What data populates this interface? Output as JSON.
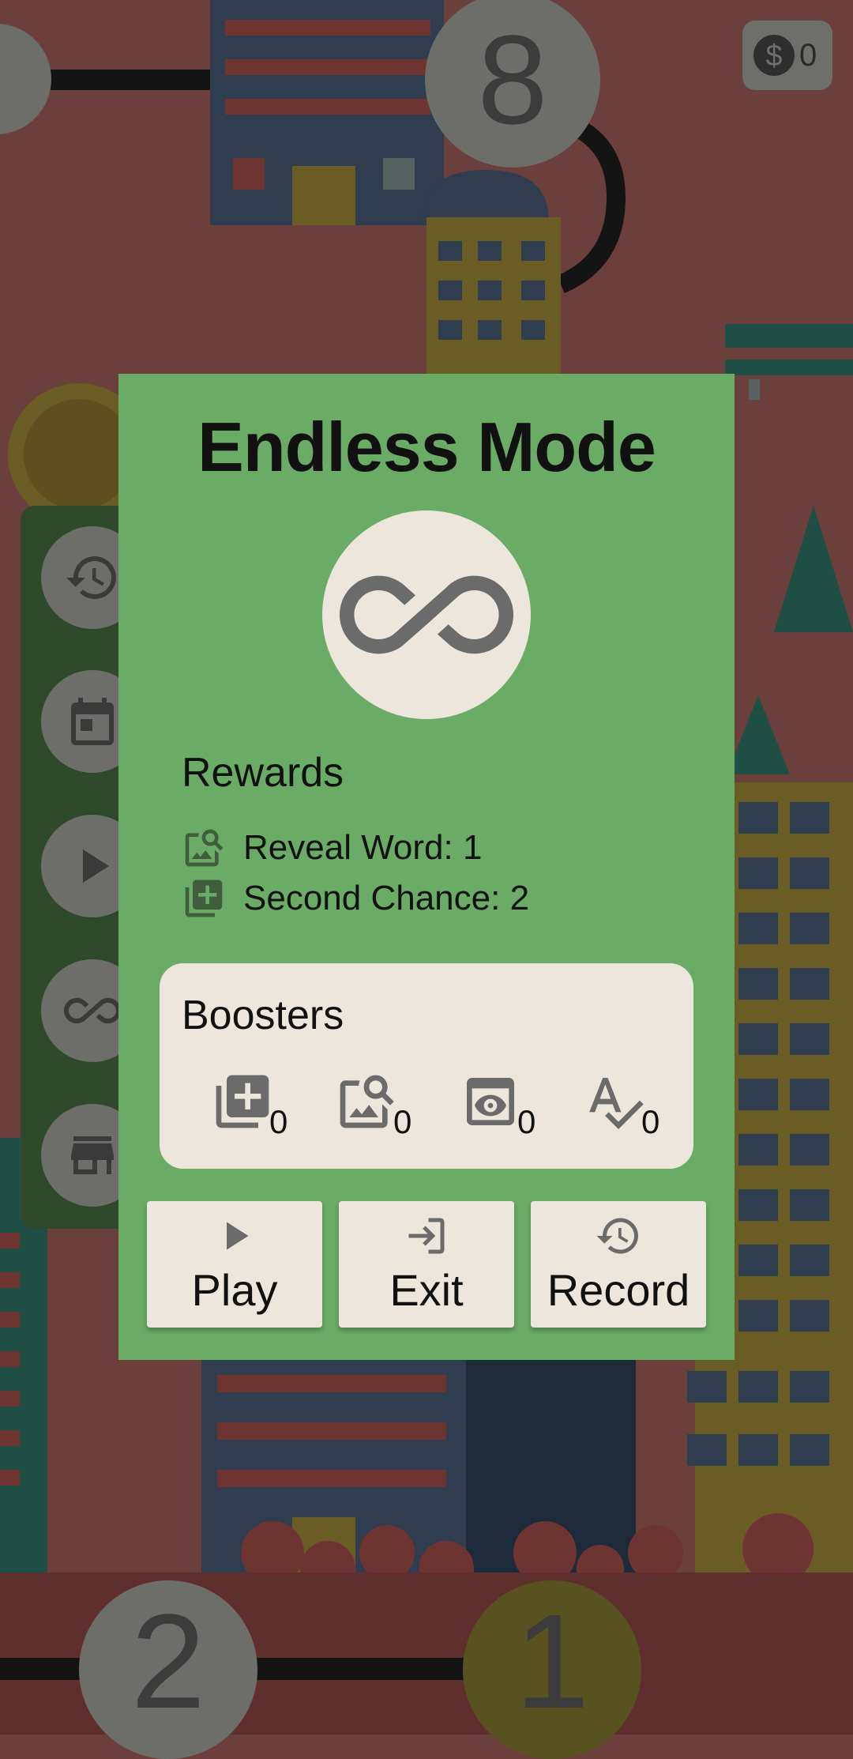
{
  "game": {
    "coins": "0",
    "level_nodes": [
      "8",
      "2",
      "1"
    ]
  },
  "side_menu": {
    "items": [
      "history-icon",
      "calendar-icon",
      "play-icon",
      "infinity-icon",
      "store-icon"
    ]
  },
  "dialog": {
    "title": "Endless Mode",
    "mode_icon": "infinity-icon",
    "rewards_title": "Rewards",
    "rewards": [
      {
        "icon": "reveal-word-icon",
        "text": "Reveal Word: 1"
      },
      {
        "icon": "second-chance-icon",
        "text": "Second Chance: 2"
      }
    ],
    "boosters_title": "Boosters",
    "boosters": [
      {
        "icon": "second-chance-icon",
        "count": "0"
      },
      {
        "icon": "reveal-word-icon",
        "count": "0"
      },
      {
        "icon": "eye-icon",
        "count": "0"
      },
      {
        "icon": "spell-check-icon",
        "count": "0"
      }
    ],
    "buttons": [
      {
        "icon": "play-icon",
        "label": "Play"
      },
      {
        "icon": "exit-icon",
        "label": "Exit"
      },
      {
        "icon": "history-icon",
        "label": "Record"
      }
    ]
  },
  "colors": {
    "dialog_bg": "#6aab66",
    "panel_bg": "#ece6dd",
    "backdrop": "#6b3f3c"
  }
}
